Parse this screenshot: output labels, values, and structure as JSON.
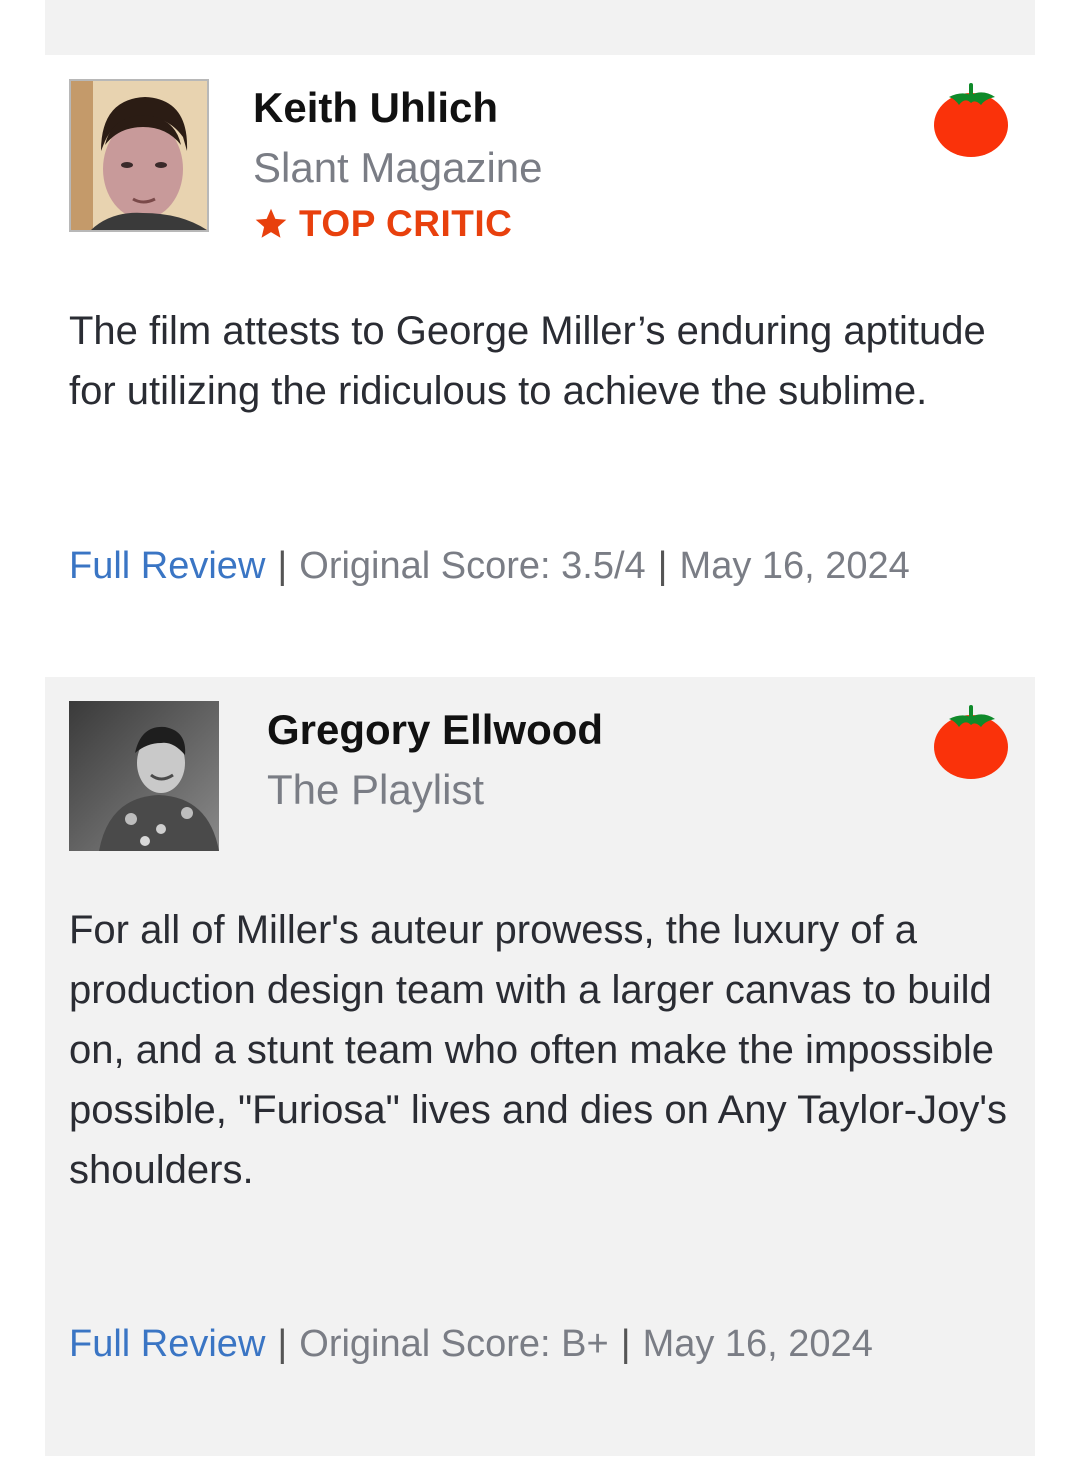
{
  "colors": {
    "link": "#3a75c4",
    "top_critic": "#e8400d",
    "tomato": "#fa320a",
    "muted_text": "#7a7d85",
    "card_alt_bg": "#f2f2f2"
  },
  "reviews": [
    {
      "critic_name": "Keith Uhlich",
      "publication": "Slant Magazine",
      "top_critic": true,
      "top_critic_label": "TOP CRITIC",
      "top_critic_icon": "star-icon",
      "score_icon": "fresh-tomato-icon",
      "quote": "The film attests to George Miller’s enduring aptitude for utilizing the ridiculous to achieve the sublime.",
      "full_review_label": "Full Review",
      "separator": "|",
      "original_score": "Original Score: 3.5/4",
      "date": "May 16, 2024"
    },
    {
      "critic_name": "Gregory Ellwood",
      "publication": "The Playlist",
      "top_critic": false,
      "score_icon": "fresh-tomato-icon",
      "quote": "For all of Miller's auteur prowess, the luxury of a production design team with a larger canvas to build on, and a stunt team who often make the impossible possible, \"Furiosa\" lives and dies on Any Taylor-Joy's shoulders.",
      "full_review_label": "Full Review",
      "separator": "|",
      "original_score": "Original Score: B+",
      "date": "May 16, 2024"
    }
  ]
}
